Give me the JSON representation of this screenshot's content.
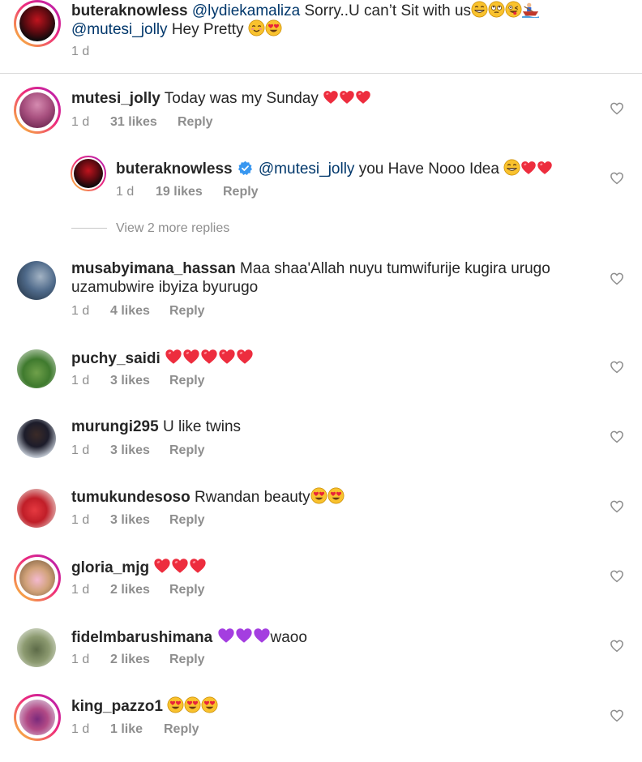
{
  "top_comment": {
    "username": "buteraknowless",
    "mention1": "@lydiekamaliza",
    "text1": " Sorry..U can’t Sit with us",
    "mention2": "@mutesi_jolly",
    "text2": " Hey Pretty ",
    "time": "1 d"
  },
  "comments": [
    {
      "username": "mutesi_jolly",
      "text": "Today was my Sunday",
      "time": "1 d",
      "likes": "31 likes",
      "reply": "Reply"
    },
    {
      "username": "musabyimana_hassan",
      "text": "Maa shaa'Allah nuyu tumwifurije kugira urugo",
      "text_line2": "uzamubwire ibyiza byurugo",
      "time": "1 d",
      "likes": "4 likes",
      "reply": "Reply"
    },
    {
      "username": "puchy_saidi",
      "text": "",
      "time": "1 d",
      "likes": "3 likes",
      "reply": "Reply"
    },
    {
      "username": "murungi295",
      "text": "U like twins",
      "time": "1 d",
      "likes": "3 likes",
      "reply": "Reply"
    },
    {
      "username": "tumukundesoso",
      "text": "Rwandan beauty",
      "time": "1 d",
      "likes": "3 likes",
      "reply": "Reply"
    },
    {
      "username": "gloria_mjg",
      "text": "",
      "time": "1 d",
      "likes": "2 likes",
      "reply": "Reply"
    },
    {
      "username": "fidelmbarushimana",
      "text": "waoo",
      "time": "1 d",
      "likes": "2 likes",
      "reply": "Reply"
    },
    {
      "username": "king_pazzo1",
      "text": "",
      "time": "1 d",
      "likes": "1 like",
      "reply": "Reply"
    }
  ],
  "nested_reply": {
    "username": "buteraknowless",
    "mention": "@mutesi_jolly",
    "text": " you Have Nooo Idea ",
    "time": "1 d",
    "likes": "19 likes",
    "reply": "Reply"
  },
  "view_more_replies": "View 2 more replies",
  "colors": {
    "heart_red": "#ed2d3e",
    "purple_heart": "#a43ee0",
    "verified_blue": "#3897f0",
    "mention": "#00376b",
    "meta_gray": "#8e8e8e"
  },
  "icons": [
    "heart-outline-icon",
    "verified-badge-icon",
    "red-heart-emoji",
    "purple-heart-emoji",
    "heart-eyes-emoji",
    "grin-emoji",
    "smile-emoji"
  ]
}
